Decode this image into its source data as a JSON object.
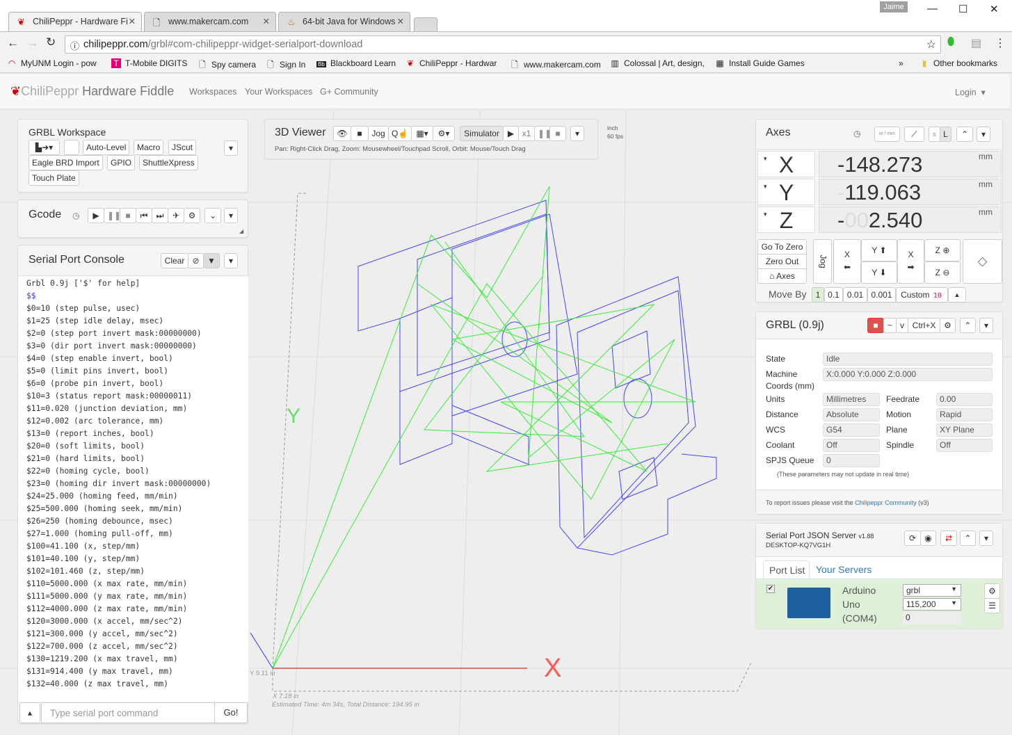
{
  "browser": {
    "tabs": [
      {
        "title": "ChiliPeppr - Hardware Fi",
        "icon": "chili-pepper-icon",
        "active": true
      },
      {
        "title": "www.makercam.com",
        "icon": "page-icon",
        "active": false
      },
      {
        "title": "64-bit Java for Windows",
        "icon": "java-icon",
        "active": false
      }
    ],
    "user": "Jaime",
    "url_host": "chilipeppr.com",
    "url_path": "/grbl#com-chilipeppr-widget-serialport-download",
    "bookmarks": [
      {
        "label": "MyUNM Login - pow",
        "icon": "unm-icon"
      },
      {
        "label": "T-Mobile DIGITS",
        "icon": "tmobile-icon"
      },
      {
        "label": "Spy camera",
        "icon": "page-icon"
      },
      {
        "label": "Sign In",
        "icon": "page-icon"
      },
      {
        "label": "Blackboard Learn",
        "icon": "blackboard-icon"
      },
      {
        "label": "ChiliPeppr - Hardwar",
        "icon": "chili-pepper-icon"
      },
      {
        "label": "www.makercam.com",
        "icon": "page-icon"
      },
      {
        "label": "Colossal | Art, design,",
        "icon": "colossal-icon"
      },
      {
        "label": "Install Guide Games",
        "icon": "games-icon"
      }
    ],
    "more_bookmarks": "»",
    "other_bookmarks": "Other bookmarks"
  },
  "nav": {
    "brand_chili": "ChiliPeppr",
    "brand_rest": "Hardware Fiddle",
    "links": [
      "Workspaces",
      "Your Workspaces",
      "G+ Community"
    ],
    "login": "Login"
  },
  "workspace": {
    "title": "GRBL Workspace",
    "buttons": [
      "Auto-Level",
      "Macro",
      "JScut",
      "Eagle BRD Import",
      "GPIO",
      "ShuttleXpress",
      "Touch Plate"
    ]
  },
  "gcode": {
    "title": "Gcode"
  },
  "console": {
    "title": "Serial Port Console",
    "clear": "Clear",
    "lines": [
      "Grbl 0.9j ['$' for help]",
      "$$",
      "$0=10 (step pulse, usec)",
      "$1=25 (step idle delay, msec)",
      "$2=0 (step port invert mask:00000000)",
      "$3=0 (dir port invert mask:00000000)",
      "$4=0 (step enable invert, bool)",
      "$5=0 (limit pins invert, bool)",
      "$6=0 (probe pin invert, bool)",
      "$10=3 (status report mask:00000011)",
      "$11=0.020 (junction deviation, mm)",
      "$12=0.002 (arc tolerance, mm)",
      "$13=0 (report inches, bool)",
      "$20=0 (soft limits, bool)",
      "$21=0 (hard limits, bool)",
      "$22=0 (homing cycle, bool)",
      "$23=0 (homing dir invert mask:00000000)",
      "$24=25.000 (homing feed, mm/min)",
      "$25=500.000 (homing seek, mm/min)",
      "$26=250 (homing debounce, msec)",
      "$27=1.000 (homing pull-off, mm)",
      "$100=41.100 (x, step/mm)",
      "$101=40.100 (y, step/mm)",
      "$102=101.460 (z, step/mm)",
      "$110=5000.000 (x max rate, mm/min)",
      "$111=5000.000 (y max rate, mm/min)",
      "$112=4000.000 (z max rate, mm/min)",
      "$120=3000.000 (x accel, mm/sec^2)",
      "$121=300.000 (y accel, mm/sec^2)",
      "$122=700.000 (z accel, mm/sec^2)",
      "$130=1219.200 (x max travel, mm)",
      "$131=914.400 (y max travel, mm)",
      "$132=40.000 (z max travel, mm)"
    ],
    "input_placeholder": "Type serial port command",
    "go": "Go!"
  },
  "viewer": {
    "title": "3D Viewer",
    "jog": "Jog",
    "simulator": "Simulator",
    "speed": "x1",
    "help": "Pan: Right-Click Drag, Zoom: Mousewheel/Touchpad Scroll, Orbit: Mouse/Touch Drag",
    "units": "inch",
    "fps": "60 fps",
    "axis_y": "Y",
    "axis_x": "X",
    "y_extent": "Y 9.11 in",
    "x_extent": "X 7.18 in",
    "estimate": "Estimated Time: 4m 34s, Total Distance: 194.95 in"
  },
  "axes": {
    "title": "Axes",
    "inmm": "in / mm",
    "s": "s",
    "l": "L",
    "rows": [
      {
        "axis": "X",
        "sign": "-",
        "dim": "",
        "value": "148.273",
        "unit": "mm"
      },
      {
        "axis": "Y",
        "sign": "-",
        "dim": "",
        "value": "119.063",
        "unit": "mm",
        "sign_dim": true
      },
      {
        "axis": "Z",
        "sign": "-",
        "dim": "00",
        "value": "2.540",
        "unit": "mm"
      }
    ],
    "go_to_zero": "Go To Zero",
    "zero_out": "Zero Out",
    "home_axes": "Axes",
    "jog": "Jog",
    "x": "X",
    "y": "Y",
    "z": "Z",
    "move_by": "Move By",
    "steps": [
      "1",
      "0.1",
      "0.01",
      "0.001"
    ],
    "custom": "Custom",
    "custom_value": "10"
  },
  "grbl": {
    "title": "GRBL (0.9j)",
    "tilde": "~",
    "v": "v",
    "ctrlx": "Ctrl+X",
    "state_label": "State",
    "state": "Idle",
    "machine_label1": "Machine",
    "machine_label2": "Coords (mm)",
    "machine": "X:0.000 Y:0.000 Z:0.000",
    "units_label": "Units",
    "units": "Millimetres",
    "feedrate_label": "Feedrate",
    "feedrate": "0.00",
    "distance_label": "Distance",
    "distance": "Absolute",
    "motion_label": "Motion",
    "motion": "Rapid",
    "wcs_label": "WCS",
    "wcs": "G54",
    "plane_label": "Plane",
    "plane": "XY Plane",
    "coolant_label": "Coolant",
    "coolant": "Off",
    "spindle_label": "Spindle",
    "spindle": "Off",
    "queue_label": "SPJS Queue",
    "queue": "0",
    "note": "(These parameters may not update in real time)",
    "report_prefix": "To report issues please visit the",
    "report_link": "Chilipeppr Community",
    "report_suffix": "(v3)"
  },
  "spjs": {
    "title": "Serial Port JSON Server",
    "version": "v1.88",
    "host": "DESKTOP-KQ7VG1H",
    "tab_ports": "Port List",
    "tab_servers": "Your Servers",
    "port": {
      "line1": "Arduino",
      "line2": "Uno",
      "line3": "(COM4)",
      "buffer": "grbl",
      "baud": "115,200",
      "queue": "0",
      "checked": true
    }
  },
  "colors": {
    "accent_red": "#d9534f",
    "link_blue": "#337ab7",
    "toolpath_blue": "#3333ff",
    "toolpath_green": "#33ee33",
    "port_row_green": "#dff0d8"
  }
}
